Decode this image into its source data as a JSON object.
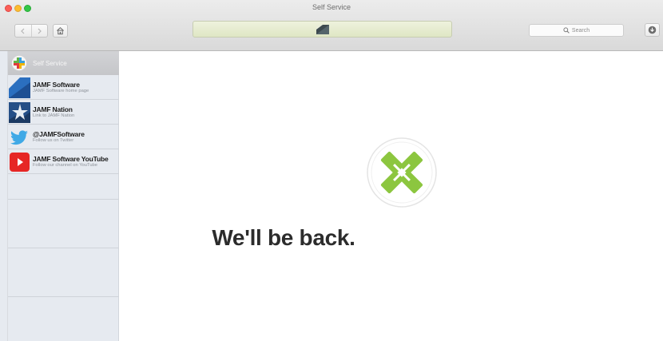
{
  "window": {
    "title": "Self Service"
  },
  "toolbar": {
    "back_icon": "chevron-left-icon",
    "forward_icon": "chevron-right-icon",
    "home_icon": "home-icon",
    "status_icon": "jamf-mark-icon",
    "search_placeholder": "Search",
    "download_icon": "download-icon"
  },
  "sidebar": {
    "header": {
      "label": "Self Service",
      "icon": "self-service-icon"
    },
    "items": [
      {
        "title": "JAMF Software",
        "subtitle": "JAMF Software home page",
        "icon": "jamf-software-icon",
        "color": "#2b6fbf"
      },
      {
        "title": "JAMF Nation",
        "subtitle": "Link to JAMF Nation",
        "icon": "jamf-nation-icon",
        "color": "#254f87"
      },
      {
        "title": "@JAMFSoftware",
        "subtitle": "Follow us on Twitter",
        "icon": "twitter-icon",
        "color": "#3fa9e6"
      },
      {
        "title": "JAMF Software YouTube",
        "subtitle": "Follow our channel on YouTube",
        "icon": "youtube-icon",
        "color": "#e62725"
      }
    ]
  },
  "main": {
    "message": "We'll be back.",
    "logo_icon": "jamf-cross-logo-icon",
    "logo_color": "#8cc63f"
  }
}
